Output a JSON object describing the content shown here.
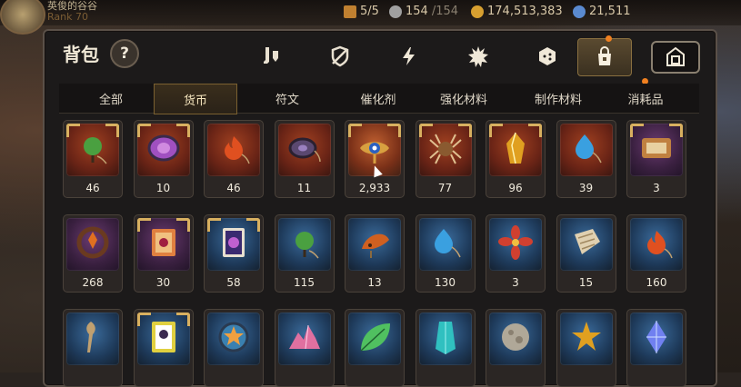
{
  "topbar": {
    "player_name": "英俊的谷谷",
    "rank_text": "Rank 70",
    "stamina": "5/5",
    "wings_current": "154",
    "wings_max": "/154",
    "gold": "174,513,383",
    "crystals": "21,511"
  },
  "panel": {
    "title": "背包",
    "help_label": "?"
  },
  "categories": [
    {
      "name": "equipment",
      "icon": "sword-shield-icon",
      "active": false
    },
    {
      "name": "shield",
      "icon": "shield-slash-icon",
      "active": false
    },
    {
      "name": "skill",
      "icon": "lightning-icon",
      "active": false
    },
    {
      "name": "spirit",
      "icon": "spiky-burst-icon",
      "active": false
    },
    {
      "name": "dice",
      "icon": "dice-icon",
      "active": false
    },
    {
      "name": "bag",
      "icon": "bag-icon",
      "active": true,
      "badge": true
    },
    {
      "name": "storage",
      "icon": "house-icon",
      "active": false,
      "boxed": true
    }
  ],
  "subtabs": [
    "全部",
    "货币",
    "符文",
    "催化剂",
    "强化材料",
    "制作材料",
    "消耗品"
  ],
  "active_subtab": 1,
  "items": [
    {
      "count": "46",
      "bg": "r-red",
      "icon": "green-leaf-pendant-icon",
      "color": "#4aa040",
      "corners": true
    },
    {
      "count": "10",
      "bg": "r-red",
      "icon": "purple-coin-icon",
      "color": "#a050c0",
      "corners": true
    },
    {
      "count": "46",
      "bg": "r-red",
      "icon": "fire-pendant-icon",
      "color": "#e05020",
      "corners": false
    },
    {
      "count": "11",
      "bg": "r-red",
      "icon": "dark-disc-icon",
      "color": "#5a4870",
      "corners": false
    },
    {
      "count": "2,933",
      "bg": "r-gold",
      "icon": "eye-emblem-icon",
      "color": "#d8a040",
      "corners": true
    },
    {
      "count": "77",
      "bg": "r-red",
      "icon": "spider-icon",
      "color": "#8a5a30",
      "corners": true
    },
    {
      "count": "96",
      "bg": "r-red",
      "icon": "gold-shard-icon",
      "color": "#e0a020",
      "corners": true
    },
    {
      "count": "39",
      "bg": "r-red",
      "icon": "blue-drop-pendant-icon",
      "color": "#3aa0e0",
      "corners": false
    },
    {
      "count": "3",
      "bg": "r-purple",
      "icon": "ticket-icon",
      "color": "#c08040",
      "corners": true
    },
    {
      "count": "268",
      "bg": "r-purple",
      "icon": "orange-ring-icon",
      "color": "#e07020",
      "corners": false
    },
    {
      "count": "30",
      "bg": "r-purple",
      "icon": "ticket-stack-icon",
      "color": "#e08040",
      "corners": true
    },
    {
      "count": "58",
      "bg": "r-blue",
      "icon": "card-icon",
      "color": "#c060d0",
      "corners": true
    },
    {
      "count": "115",
      "bg": "r-blue",
      "icon": "green-leaf-pendant-icon",
      "color": "#4aa040",
      "corners": false
    },
    {
      "count": "13",
      "bg": "r-blue",
      "icon": "fire-shell-icon",
      "color": "#d06020",
      "corners": false
    },
    {
      "count": "130",
      "bg": "r-blue",
      "icon": "blue-drop-pendant-icon",
      "color": "#3aa0e0",
      "corners": false
    },
    {
      "count": "3",
      "bg": "r-blue",
      "icon": "red-flower-icon",
      "color": "#d04030",
      "corners": false
    },
    {
      "count": "15",
      "bg": "r-blue",
      "icon": "scroll-icon",
      "color": "#e0d0b0",
      "corners": false
    },
    {
      "count": "160",
      "bg": "r-blue",
      "icon": "fire-pendant-icon",
      "color": "#e05020",
      "corners": false
    },
    {
      "count": "",
      "bg": "r-blue",
      "icon": "brush-icon",
      "color": "#c0a070",
      "corners": false
    },
    {
      "count": "",
      "bg": "r-blue",
      "icon": "tarot-card-icon",
      "color": "#e0d040",
      "corners": true
    },
    {
      "count": "",
      "bg": "r-blue",
      "icon": "star-coin-icon",
      "color": "#3a80b0",
      "corners": false
    },
    {
      "count": "",
      "bg": "r-blue",
      "icon": "pink-crystal-icon",
      "color": "#e070a0",
      "corners": false
    },
    {
      "count": "",
      "bg": "r-blue",
      "icon": "green-leaf-icon",
      "color": "#50c060",
      "corners": false
    },
    {
      "count": "",
      "bg": "r-blue",
      "icon": "cyan-gem-icon",
      "color": "#30c0c0",
      "corners": false
    },
    {
      "count": "",
      "bg": "r-blue",
      "icon": "stone-orb-icon",
      "color": "#b0a898",
      "corners": false
    },
    {
      "count": "",
      "bg": "r-blue",
      "icon": "gold-star-icon",
      "color": "#e0a020",
      "corners": false
    },
    {
      "count": "",
      "bg": "r-blue",
      "icon": "blue-crystal-icon",
      "color": "#7080f0",
      "corners": false
    }
  ]
}
